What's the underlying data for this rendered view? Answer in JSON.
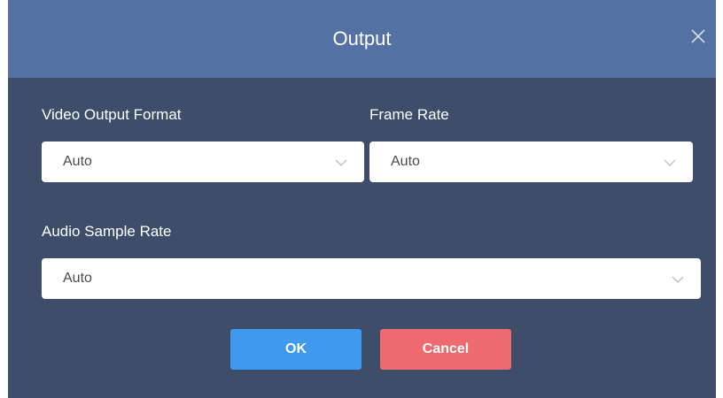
{
  "dialog": {
    "title": "Output",
    "close_icon": "close-icon"
  },
  "fields": {
    "video_output_format": {
      "label": "Video Output Format",
      "value": "Auto"
    },
    "frame_rate": {
      "label": "Frame Rate",
      "value": "Auto"
    },
    "audio_sample_rate": {
      "label": "Audio Sample Rate",
      "value": "Auto"
    }
  },
  "buttons": {
    "ok_label": "OK",
    "cancel_label": "Cancel"
  },
  "colors": {
    "title_bar": "#5471a3",
    "body": "#3d4d6a",
    "ok": "#3e9aee",
    "cancel": "#ed6b6e"
  }
}
